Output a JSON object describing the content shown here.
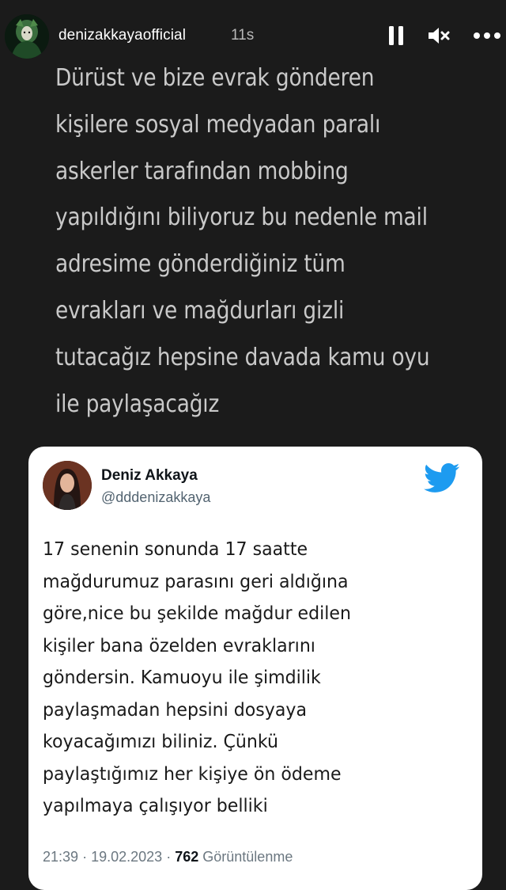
{
  "story": {
    "username": "denizakkayaofficial",
    "time_ago": "11s",
    "text": "Dürüst ve bize evrak gönderen\nkişilere sosyal medyadan paralı\naskerler tarafından mobbing\nyapıldığını biliyoruz bu nedenle mail\nadresime gönderdiğiniz tüm\nevrakları ve mağdurları gizli\ntutacağız hepsine davada kamu oyu\nile paylaşacağız",
    "controls": {
      "pause_icon": "pause-icon",
      "mute_icon": "speaker-muted-icon",
      "more_icon": "more-horizontal-icon"
    }
  },
  "tweet": {
    "name": "Deniz Akkaya",
    "handle": "@dddenizakkaya",
    "body": "17 senenin sonunda 17 saatte\nmağdurumuz parasını geri aldığına\ngöre,nice bu şekilde mağdur edilen\nkişiler bana özelden evraklarını\ngöndersin. Kamuoyu ile şimdilik\npaylaşmadan hepsini dosyaya\nkoyacağımızı biliniz. Çünkü\npaylaştığımız her kişiye ön ödeme\nyapılmaya çalışıyor belliki",
    "time": "21:39",
    "date": "19.02.2023",
    "separator": "·",
    "views_count": "762",
    "views_label": "Görüntülenme",
    "logo_icon": "twitter-bird-icon"
  },
  "colors": {
    "background": "#1b1b1b",
    "story_text": "#c9c9c9",
    "twitter_blue": "#1d9bf0",
    "card": "#ffffff"
  }
}
